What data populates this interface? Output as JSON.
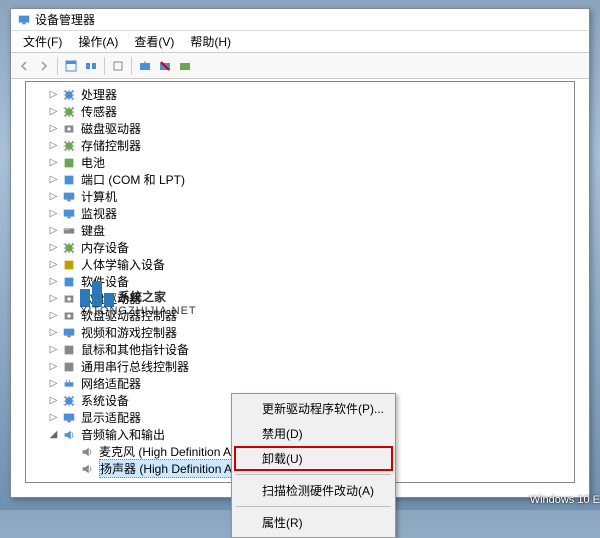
{
  "window": {
    "title": "设备管理器"
  },
  "menu": {
    "file": "文件(F)",
    "action": "操作(A)",
    "view": "查看(V)",
    "help": "帮助(H)"
  },
  "tree": {
    "root": "",
    "items": [
      "处理器",
      "传感器",
      "磁盘驱动器",
      "存储控制器",
      "电池",
      "端口 (COM 和 LPT)",
      "计算机",
      "监视器",
      "键盘",
      "内存设备",
      "人体学输入设备",
      "软件设备",
      "软盘驱动器",
      "软盘驱动器控制器",
      "视频和游戏控制器",
      "鼠标和其他指针设备",
      "通用串行总线控制器",
      "网络适配器",
      "系统设备",
      "显示适配器",
      "音频输入和输出"
    ],
    "audio_children": {
      "mic": "麦克风 (High Definition Audio 设备)",
      "speaker": "扬声器 (High Definition Audio 设备)"
    }
  },
  "context_menu": {
    "update": "更新驱动程序软件(P)...",
    "disable": "禁用(D)",
    "uninstall": "卸载(U)",
    "scan": "扫描检测硬件改动(A)",
    "properties": "属性(R)"
  },
  "watermark": {
    "main": "系统之家",
    "sub": "XITONGZHIJIA.NET"
  },
  "footer": {
    "windows": "Windows 10 E"
  },
  "icons": {
    "cpu": "#4a90d9",
    "sensor": "#6aa84f",
    "disk": "#888",
    "storage": "#6aa84f",
    "battery": "#6aa84f",
    "port": "#4a90d9",
    "computer": "#4a90d9",
    "monitor": "#4a90d9",
    "keyboard": "#888",
    "memory": "#6aa84f",
    "hid": "#c0a000",
    "software": "#4a90d9",
    "floppy": "#888",
    "floppyctl": "#888",
    "video": "#4a90d9",
    "mouse": "#888",
    "usb": "#888",
    "network": "#4a90d9",
    "system": "#4a90d9",
    "display": "#4a90d9",
    "audio": "#4a90d9",
    "speaker": "#888",
    "mic": "#888"
  }
}
